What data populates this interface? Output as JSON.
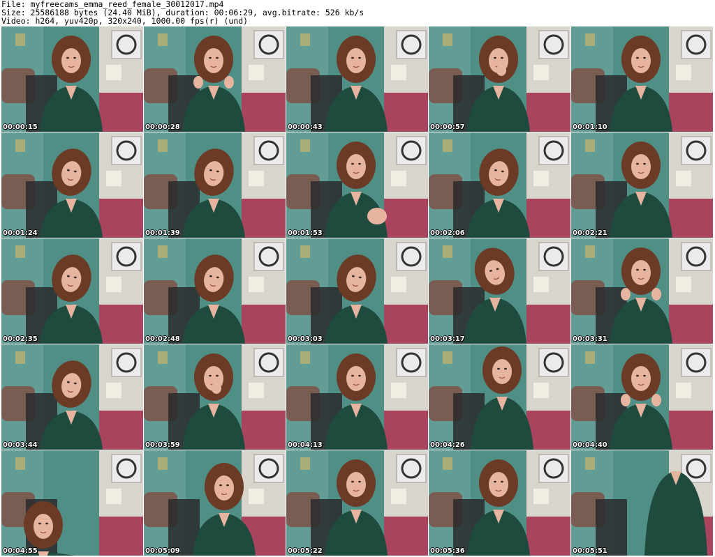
{
  "header": {
    "file_line": "File: myfreecams_emma_reed_female_30012017.mp4",
    "size_line": "Size: 25586188 bytes (24.40 MiB), duration: 00:06:29, avg.bitrate: 526 kb/s",
    "video_line": "Video: h264, yuv420p, 320x240, 1000.00 fps(r) (und)"
  },
  "thumbnails": [
    {
      "time": "00:00:15",
      "variant": "seated"
    },
    {
      "time": "00:00:28",
      "variant": "hands-hair"
    },
    {
      "time": "00:00:43",
      "variant": "laughing"
    },
    {
      "time": "00:00:57",
      "variant": "hand-mouth"
    },
    {
      "time": "00:01:10",
      "variant": "seated"
    },
    {
      "time": "00:01:24",
      "variant": "looking-down"
    },
    {
      "time": "00:01:39",
      "variant": "looking-down"
    },
    {
      "time": "00:01:53",
      "variant": "hand-wave"
    },
    {
      "time": "00:02:06",
      "variant": "looking-down"
    },
    {
      "time": "00:02:21",
      "variant": "seated"
    },
    {
      "time": "00:02:35",
      "variant": "looking-down"
    },
    {
      "time": "00:02:48",
      "variant": "looking-down"
    },
    {
      "time": "00:03:03",
      "variant": "looking-down"
    },
    {
      "time": "00:03:17",
      "variant": "side-view"
    },
    {
      "time": "00:03:31",
      "variant": "arms-gesture"
    },
    {
      "time": "00:03:44",
      "variant": "looking-down"
    },
    {
      "time": "00:03:59",
      "variant": "hand-mouth"
    },
    {
      "time": "00:04:13",
      "variant": "seated"
    },
    {
      "time": "00:04:26",
      "variant": "standing-back"
    },
    {
      "time": "00:04:40",
      "variant": "arms-gesture"
    },
    {
      "time": "00:04:55",
      "variant": "bending"
    },
    {
      "time": "00:05:09",
      "variant": "sitting-floor"
    },
    {
      "time": "00:05:22",
      "variant": "standing"
    },
    {
      "time": "00:05:36",
      "variant": "laughing"
    },
    {
      "time": "00:05:51",
      "variant": "close-body"
    }
  ],
  "colors": {
    "wall_teal": "#4f8f86",
    "wall_light": "#d9d4cc",
    "poster_white": "#ecebea",
    "bedspread": "#a8445e",
    "chair_black": "#2a2a2c",
    "pillow_brown": "#7a5d52",
    "sweater_green": "#1f4b3e",
    "hair_brown": "#6b3b26",
    "skin": "#e6b49f"
  }
}
